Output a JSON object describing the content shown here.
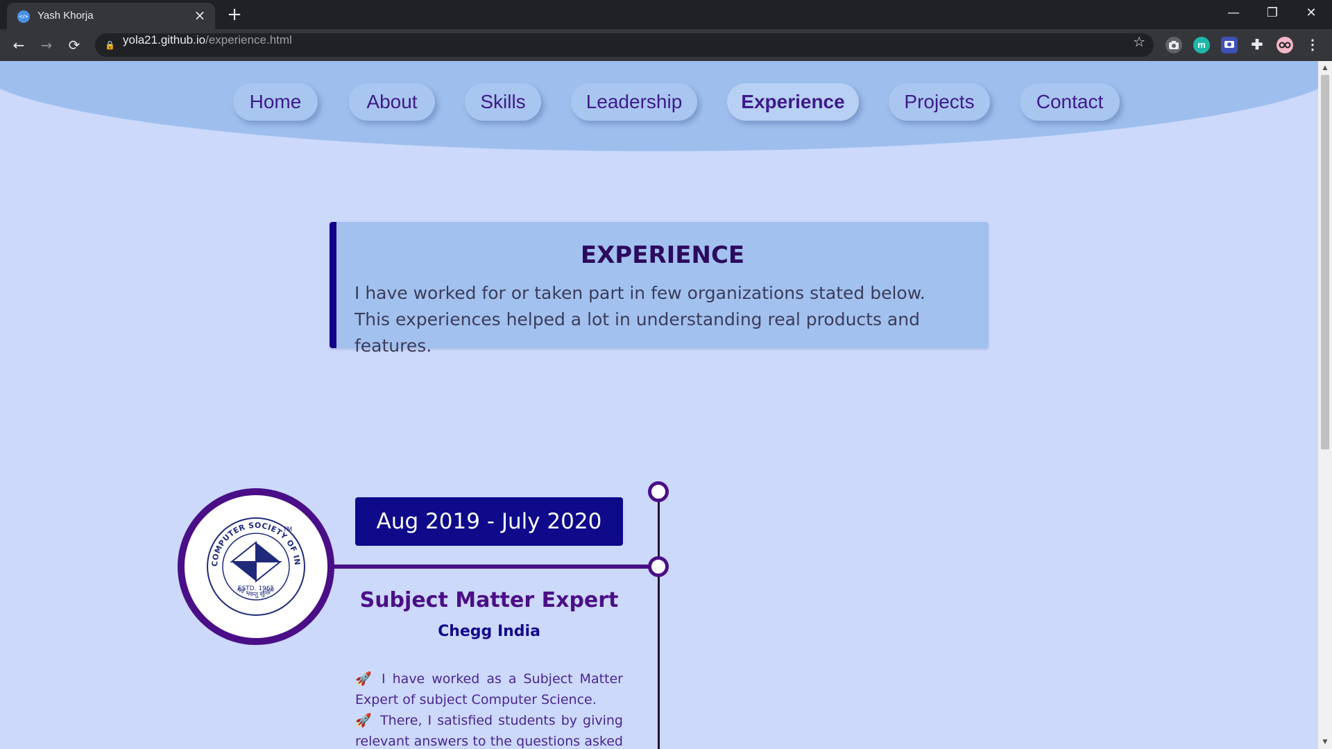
{
  "browser": {
    "tab": {
      "title": "Yash Khorja",
      "favicon": "</>"
    },
    "url": {
      "host": "yola21.github.io",
      "path": "/experience.html"
    },
    "icons": {
      "back": "←",
      "forward": "→",
      "reload": "⟳",
      "lock": "🔒",
      "star": "☆",
      "close_tab": "×",
      "new_tab": "+",
      "minimize": "—",
      "maximize": "❐",
      "close_window": "✕",
      "extension_m": "m",
      "puzzle": "✚",
      "menu": "⋮"
    }
  },
  "nav": {
    "items": [
      {
        "label": "Home"
      },
      {
        "label": "About"
      },
      {
        "label": "Skills"
      },
      {
        "label": "Leadership"
      },
      {
        "label": "Experience",
        "active": true
      },
      {
        "label": "Projects"
      },
      {
        "label": "Contact"
      }
    ]
  },
  "experience_intro": {
    "title": "EXPERIENCE",
    "description": "I have worked for or taken part in few organizations stated below. This experiences helped a lot in understanding real products and features."
  },
  "timeline": [
    {
      "date": "Aug 2019 - July 2020",
      "role": "Subject Matter Expert",
      "company": "Chegg India",
      "logo": {
        "text_ring": "COMPUTER SOCIETY OF INDIA",
        "trademark": "TM",
        "established": "ESTD. 1965",
        "motto": "सर्वे भवन्तु सुखिनः"
      },
      "bullet_icon": "🚀",
      "points": [
        "I have worked as a Subject Matter Expert of subject Computer Science.",
        "There, I satisfied students by giving relevant answers to the questions asked by"
      ]
    }
  ],
  "colors": {
    "page_bg": "#ccd9fb",
    "header_bg": "#9ebfee",
    "accent_purple": "#4a0f87",
    "accent_navy": "#0e0a8a"
  }
}
